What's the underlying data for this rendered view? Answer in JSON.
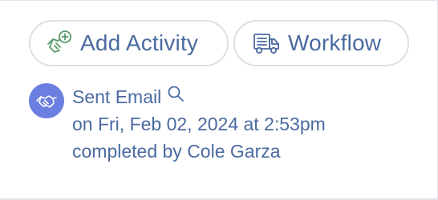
{
  "toolbar": {
    "add_activity_label": "Add Activity",
    "workflow_label": "Workflow",
    "add_activity_icon": "handshake-plus-icon",
    "workflow_icon": "truck-icon"
  },
  "activity": {
    "icon": "handshake-icon",
    "title": "Sent Email",
    "title_icon": "search-icon",
    "date_line": "on Fri, Feb 02, 2024 at 2:53pm",
    "completed_line": "completed by Cole Garza"
  },
  "colors": {
    "text": "#4a6aa0",
    "accent_green": "#5a9a6a",
    "avatar_bg": "#6a7fe0",
    "border": "#dcdfe4"
  }
}
